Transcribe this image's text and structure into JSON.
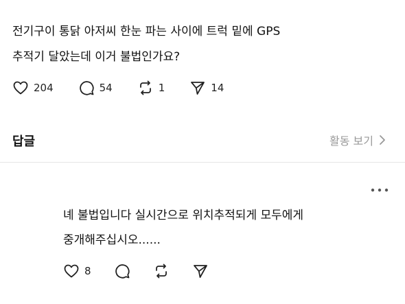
{
  "post": {
    "lines": [
      "전기구이 통닭 아저씨 한눈 파는 사이에 트럭 밑에 GPS",
      "추적기 달았는데 이거 불법인가요?"
    ],
    "likes": "204",
    "replies": "54",
    "reposts": "1",
    "shares": "14"
  },
  "replies_section": {
    "title": "답글",
    "activity_link": "활동 보기"
  },
  "reply": {
    "lines": [
      "녜 불법입니다 실시간으로 위치추적되게 모두에게",
      "중개해주십시오......"
    ],
    "likes": "8"
  },
  "icons": {
    "like": "heart-icon",
    "reply": "speech-bubble-icon",
    "repost": "repost-arrows-icon",
    "share": "send-plane-icon",
    "more": "more-dots-icon",
    "chevron": "chevron-right-icon"
  }
}
